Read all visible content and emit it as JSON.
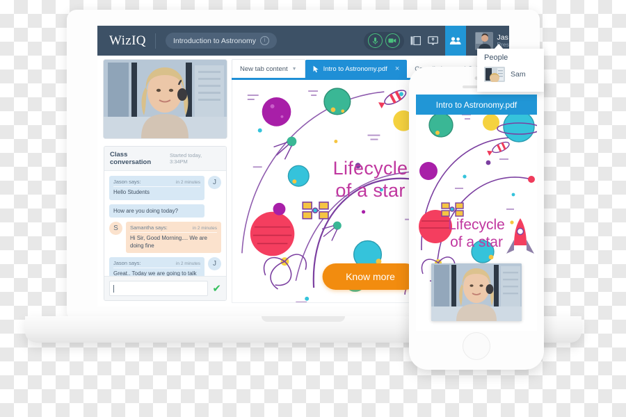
{
  "app": {
    "brand": "WizIQ",
    "course_pill": {
      "label": "Introduction to Astronomy",
      "info_icon": "info-icon"
    },
    "toolbar": {
      "mic_icon": "microphone-icon",
      "camera_icon": "video-camera-icon",
      "layout_icon": "layout-panel-icon",
      "screenshare_icon": "screen-share-icon",
      "people_icon": "people-icon"
    },
    "user": {
      "name": "Jas",
      "role": "Pres",
      "avatar": "user-avatar"
    }
  },
  "people_panel": {
    "title": "People",
    "members": [
      {
        "name": "Sam",
        "avatar": "participant-avatar"
      }
    ]
  },
  "video_tile": {
    "label": "presenter-webcam"
  },
  "chat": {
    "title": "Class conversation",
    "started": "Started today, 3:34PM",
    "messages": [
      {
        "author": "Jason says:",
        "time": "in 2 minutes",
        "text": "Hello Students",
        "side": "left",
        "tone": "blue",
        "initial": "J"
      },
      {
        "author": "",
        "time": "",
        "text": "How are you doing today?",
        "side": "left",
        "tone": "blue",
        "initial": ""
      },
      {
        "author": "Samantha says:",
        "time": "in 2 minutes",
        "text": "Hi Sir, Good Morning.... We are doing fine",
        "side": "right",
        "tone": "peach",
        "initial": "S"
      },
      {
        "author": "Jason says:",
        "time": "in 2 minutes",
        "text": "Great.. Today we are going to talk about Quantum Physics",
        "side": "left",
        "tone": "blue",
        "initial": "J"
      }
    ],
    "input_value": "",
    "send_icon": "check-icon"
  },
  "tabs": [
    {
      "label": "New tab content",
      "state": "plain",
      "icon": "chevron-down-icon"
    },
    {
      "label": "Intro to Astronomy.pdf",
      "state": "active",
      "icon": "cursor-icon",
      "close_icon": "close-icon"
    },
    {
      "label": "Contellations and Galaxies",
      "state": "inactive",
      "icon": ""
    }
  ],
  "slide": {
    "title_line1": "Lifecycle",
    "title_line2": "of a star",
    "title_color": "#c0379f",
    "illustration": "astronomy-space-illustration"
  },
  "cta": {
    "label": "Know more",
    "color": "#f28c0f"
  },
  "phone": {
    "header_title": "Intro to Astronomy.pdf",
    "header_color": "#2196d6",
    "title_line1": "Lifecycle",
    "title_line2": "of a star",
    "video_label": "presenter-webcam",
    "home_button": "home-button"
  },
  "colors": {
    "header_navy": "#3d5166",
    "accent_blue": "#2196d6",
    "accent_orange": "#f28c0f",
    "accent_magenta": "#c0379f",
    "status_green": "#49c07e"
  }
}
